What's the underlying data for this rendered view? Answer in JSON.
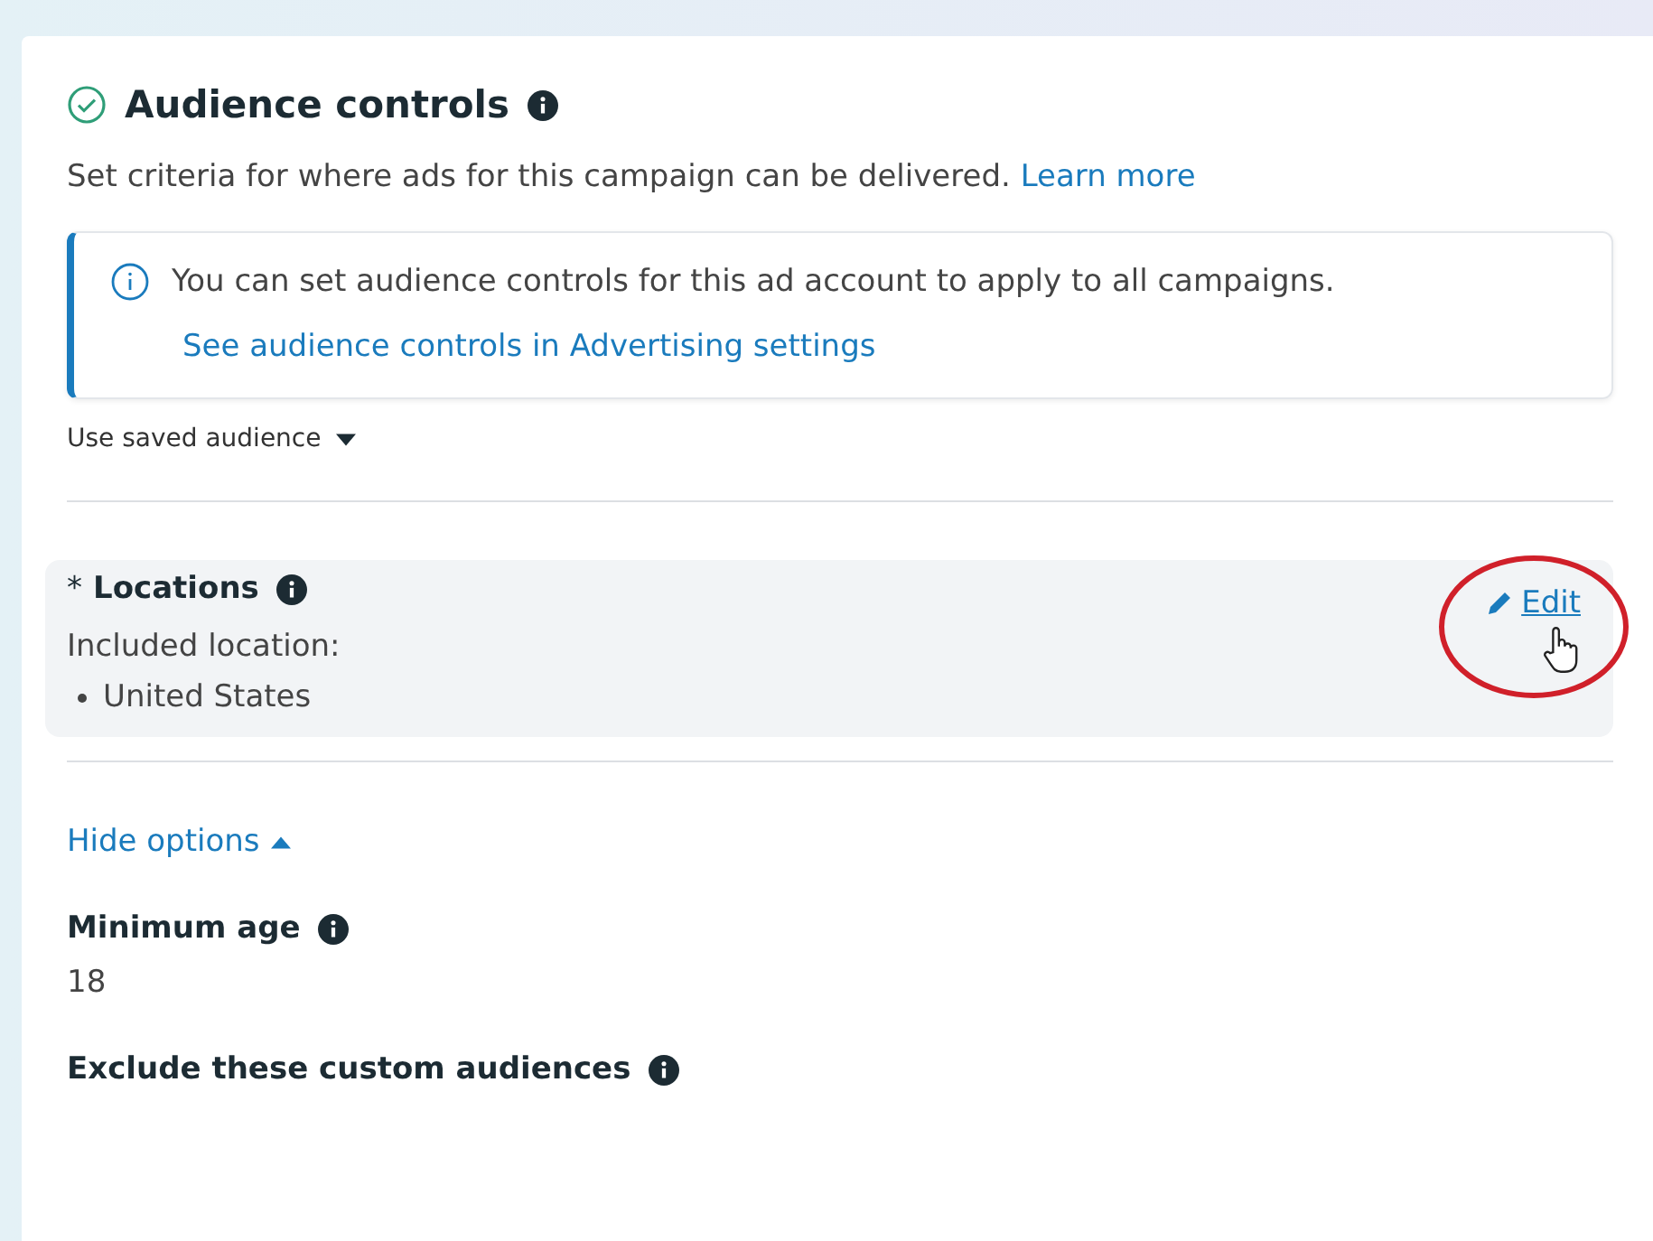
{
  "section": {
    "title": "Audience controls",
    "complete": true,
    "description": "Set criteria for where ads for this campaign can be delivered.",
    "learn_more": "Learn more"
  },
  "notice": {
    "text": "You can set audience controls for this ad account to apply to all campaigns.",
    "link": "See audience controls in Advertising settings"
  },
  "saved_audience": {
    "label": "Use saved audience",
    "expanded": false
  },
  "locations": {
    "required_mark": "*",
    "title": "Locations",
    "edit": "Edit",
    "subtitle": "Included location:",
    "items": [
      "United States"
    ]
  },
  "options_toggle": {
    "label": "Hide options",
    "expanded": true
  },
  "fields": [
    {
      "label": "Minimum age",
      "value": "18"
    },
    {
      "label": "Exclude these custom audiences"
    }
  ]
}
